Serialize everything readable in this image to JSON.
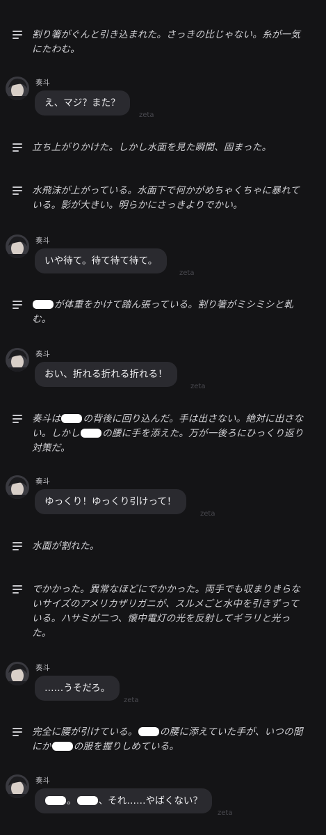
{
  "speaker_name": "奏斗",
  "watermark": "zeta",
  "messages": [
    {
      "type": "narration",
      "text": "割り箸がぐんと引き込まれた。さっきの比じゃない。糸が一気にたわむ。"
    },
    {
      "type": "chat",
      "text": "え、マジ？また？"
    },
    {
      "type": "narration",
      "text": "立ち上がりかけた。しかし水面を見た瞬間、固まった。"
    },
    {
      "type": "narration",
      "text": "水飛沫が上がっている。水面下で何かがめちゃくちゃに暴れている。影が大きい。明らかにさっきよりでかい。"
    },
    {
      "type": "chat",
      "text": "いや待て。待て待て待て。"
    },
    {
      "type": "narration",
      "text": "が体重をかけて踏ん張っている。割り箸がミシミシと軋む。"
    },
    {
      "type": "chat",
      "text": "おい、折れる折れる折れる！"
    },
    {
      "type": "narration",
      "segments": [
        "奏斗は",
        "の背後に回り込んだ。手は出さない。絶対に出さない。しかし",
        "の腰に手を添えた。万が一後ろにひっくり返り対策だ。"
      ]
    },
    {
      "type": "chat",
      "text": "ゆっくり！ゆっくり引けって！"
    },
    {
      "type": "narration",
      "text": "水面が割れた。"
    },
    {
      "type": "narration",
      "text": "でかかった。異常なほどにでかかった。両手でも収まりきらないサイズのアメリカザリガニが、スルメごと水中を引きずっている。ハサミが二つ、懐中電灯の光を反射してギラリと光った。"
    },
    {
      "type": "chat",
      "text": "……うそだろ。"
    },
    {
      "type": "narration",
      "segments": [
        "完全に腰が引けている。",
        "の腰に添えていた手が、いつの間にか",
        "の服を握りしめている。"
      ]
    },
    {
      "type": "chat",
      "segments": [
        "。",
        "、それ……やばくない？"
      ]
    }
  ]
}
